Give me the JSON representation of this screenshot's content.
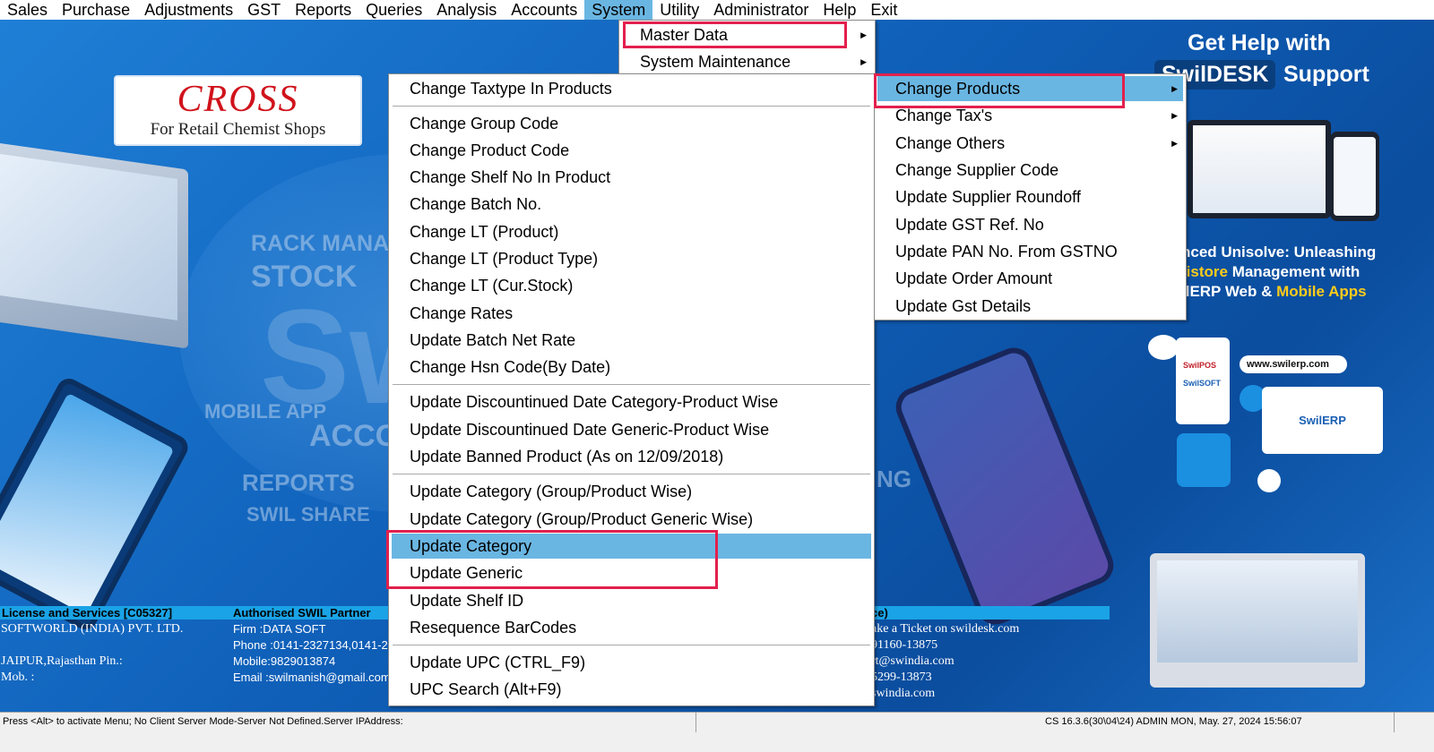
{
  "menubar": [
    "Sales",
    "Purchase",
    "Adjustments",
    "GST",
    "Reports",
    "Queries",
    "Analysis",
    "Accounts",
    "System",
    "Utility",
    "Administrator",
    "Help",
    "Exit"
  ],
  "system_menu": [
    {
      "label": "Master Data",
      "submenu": true
    },
    {
      "label": "System Maintenance",
      "submenu": true
    }
  ],
  "master_menu": [
    "Change Taxtype In Products",
    "Change Group Code",
    "Change Product Code",
    "Change Shelf No In Product",
    "Change Batch No.",
    "Change LT (Product)",
    "Change LT (Product Type)",
    "Change LT (Cur.Stock)",
    "Change Rates",
    "Update Batch Net Rate",
    "Change Hsn Code(By Date)",
    "Update Discountinued Date Category-Product Wise",
    "Update Discountinued Date Generic-Product Wise",
    "Update Banned Product (As on 12/09/2018)",
    "Update Category (Group/Product Wise)",
    "Update Category (Group/Product Generic Wise)",
    "Update Category",
    "Update Generic",
    "Update Shelf ID",
    "Resequence BarCodes",
    "Update UPC  (CTRL_F9)",
    "UPC Search (Alt+F9)"
  ],
  "products_menu": [
    {
      "label": "Change Products",
      "submenu": true
    },
    {
      "label": "Change Tax's",
      "submenu": true
    },
    {
      "label": "Change Others",
      "submenu": true
    },
    {
      "label": "Change Supplier Code",
      "submenu": false
    },
    {
      "label": "Update Supplier Roundoff",
      "submenu": false
    },
    {
      "label": "Update GST Ref. No",
      "submenu": false
    },
    {
      "label": "Update PAN No. From GSTNO",
      "submenu": false
    },
    {
      "label": "Update Order Amount",
      "submenu": false
    },
    {
      "label": "Update Gst Details",
      "submenu": false
    }
  ],
  "logo": {
    "title": "CROSS",
    "subtitle": "For Retail Chemist Shops"
  },
  "background_text": {
    "rack": "RACK MANA",
    "stock": "STOCK",
    "sw": "Sw",
    "mobile": "MOBILE APP",
    "acco": "ACCO",
    "reports": "REPORTS",
    "swil_share": "SWIL SHARE",
    "ng": "NG"
  },
  "promo": {
    "get_help": "Get Help with",
    "swildesk": "SwilDESK",
    "support": "Support",
    "line1_a": "nced Unisolve: Unleashing",
    "line2_a": "tistore",
    "line2_b": " Management with",
    "line3_a": "ilERP Web",
    "line3_b": " & ",
    "line3_c": "Mobile Apps",
    "url": "www.swilerp.com",
    "badge_pos": "SwilPOS",
    "badge_soft": "SwilSOFT",
    "badge_erp": "SwilERP"
  },
  "info_strip": {
    "license": "License and Services [C05327]",
    "partner": "Authorised SWIL Partner",
    "right": "ce)"
  },
  "license_info": [
    "SOFTWORLD (INDIA) PVT. LTD.",
    "",
    "JAIPUR,Rajasthan Pin.:",
    "Mob. :"
  ],
  "partner_info": [
    "Firm  :DATA SOFT",
    "Phone :0141-2327134,0141-2",
    "Mobile:9829013874",
    "Email :swilmanish@gmail.com"
  ],
  "support_info": [
    "ake a Ticket on swildesk.com",
    "91160-13875",
    "rt@swindia.com",
    "5299-13873",
    "swindia.com"
  ],
  "statusbar": {
    "left": "Press <Alt> to activate Menu; No Client Server Mode-Server Not Defined.Server IPAddress:",
    "right": "CS 16.3.6(30\\04\\24) ADMIN  MON, May. 27, 2024  15:56:07"
  },
  "colors": {
    "highlight": "#6ab6e2",
    "annotation": "#e2204d",
    "strip": "#1aa3e6"
  }
}
